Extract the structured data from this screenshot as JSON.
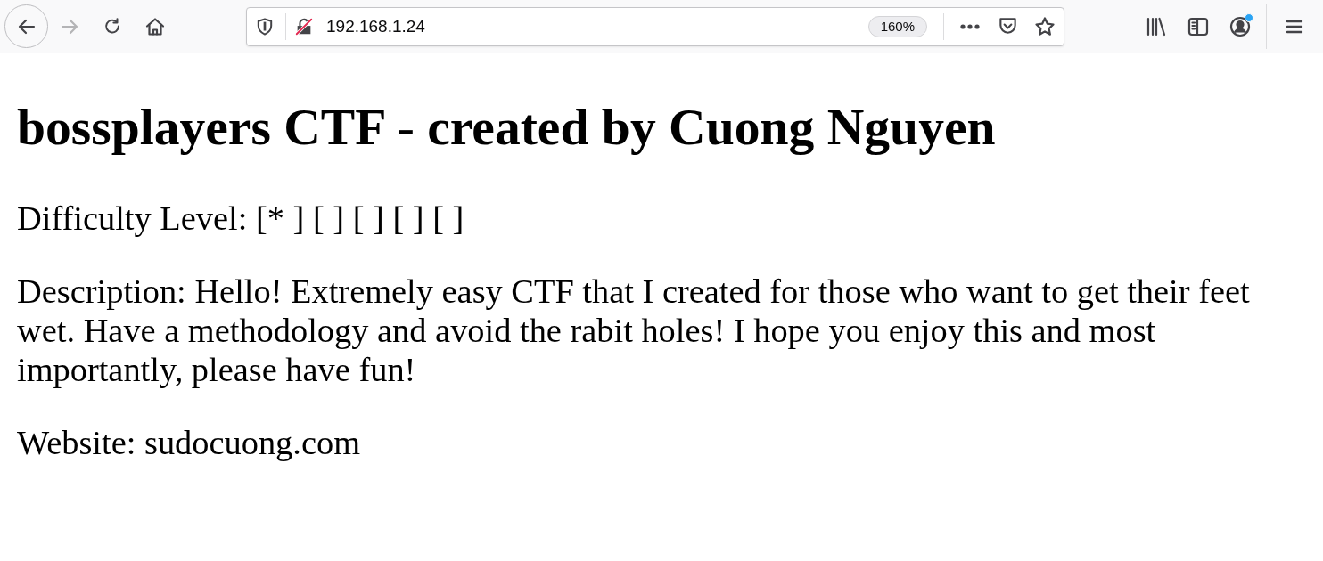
{
  "browser": {
    "navigation": [
      {
        "kind": "back",
        "disabled": false
      },
      {
        "kind": "forward",
        "disabled": true
      },
      {
        "kind": "reload",
        "disabled": false
      },
      {
        "kind": "home",
        "disabled": false
      }
    ],
    "url": "192.168.1.24",
    "zoom": "160%",
    "account": {
      "notification": true
    }
  },
  "page": {
    "heading": "bossplayers CTF - created by Cuong Nguyen",
    "difficulty": "Difficulty Level: [* ] [ ] [ ] [ ] [ ]",
    "description": "Description: Hello! Extremely easy CTF that I created for those who want to get their feet wet. Have a methodology and avoid the rabit holes! I hope you enjoy this and most importantly, please have fun!",
    "website": "Website: sudocuong.com"
  }
}
